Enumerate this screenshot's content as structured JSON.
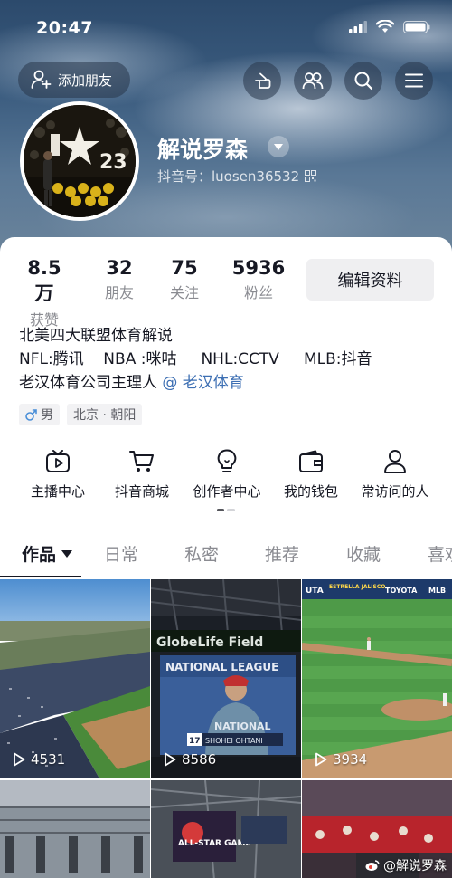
{
  "status_bar": {
    "time": "20:47"
  },
  "header": {
    "add_friend_label": "添加朋友",
    "username": "解说罗森",
    "douyin_id": "抖音号：luosen36532"
  },
  "stats": [
    {
      "value": "8.5万",
      "label": "获赞"
    },
    {
      "value": "32",
      "label": "朋友"
    },
    {
      "value": "75",
      "label": "关注"
    },
    {
      "value": "5936",
      "label": "粉丝"
    }
  ],
  "edit_profile_label": "编辑资料",
  "bio": {
    "line1": "北美四大联盟体育解说",
    "line2": "NFL:腾讯    NBA :咪咕     NHL:CCTV     MLB:抖音",
    "line3_prefix": "老汉体育公司主理人 ",
    "line3_link": "@ 老汉体育"
  },
  "tags": {
    "gender": "男",
    "location": "北京 · 朝阳"
  },
  "quick_actions": [
    {
      "label": "主播中心",
      "icon": "tv-play-icon"
    },
    {
      "label": "抖音商城",
      "icon": "shopping-cart-icon"
    },
    {
      "label": "创作者中心",
      "icon": "lightbulb-icon"
    },
    {
      "label": "我的钱包",
      "icon": "wallet-icon"
    },
    {
      "label": "常访问的人",
      "icon": "person-icon"
    }
  ],
  "tabs": [
    "作品",
    "日常",
    "私密",
    "推荐",
    "收藏",
    "喜欢"
  ],
  "videos": [
    {
      "plays": "4531"
    },
    {
      "plays": "8586"
    },
    {
      "plays": "3934"
    }
  ],
  "video_overlays": {
    "lifefield": "GlobeLife Field",
    "national_league": "NATIONAL LEAGUE",
    "player_name": "SHOHEI OHTANI",
    "player_number": "17",
    "allstar": "ALL-STAR GAME",
    "uta": "UTA",
    "estrella": "ESTRELLA JALISCO",
    "toyota": "TOYOTA",
    "mlb": "MLB"
  },
  "avatar_text": "23",
  "watermark": "@解说罗森",
  "colors": {
    "link": "#3d6fb3",
    "text": "#161823",
    "muted": "#8a8b91"
  }
}
